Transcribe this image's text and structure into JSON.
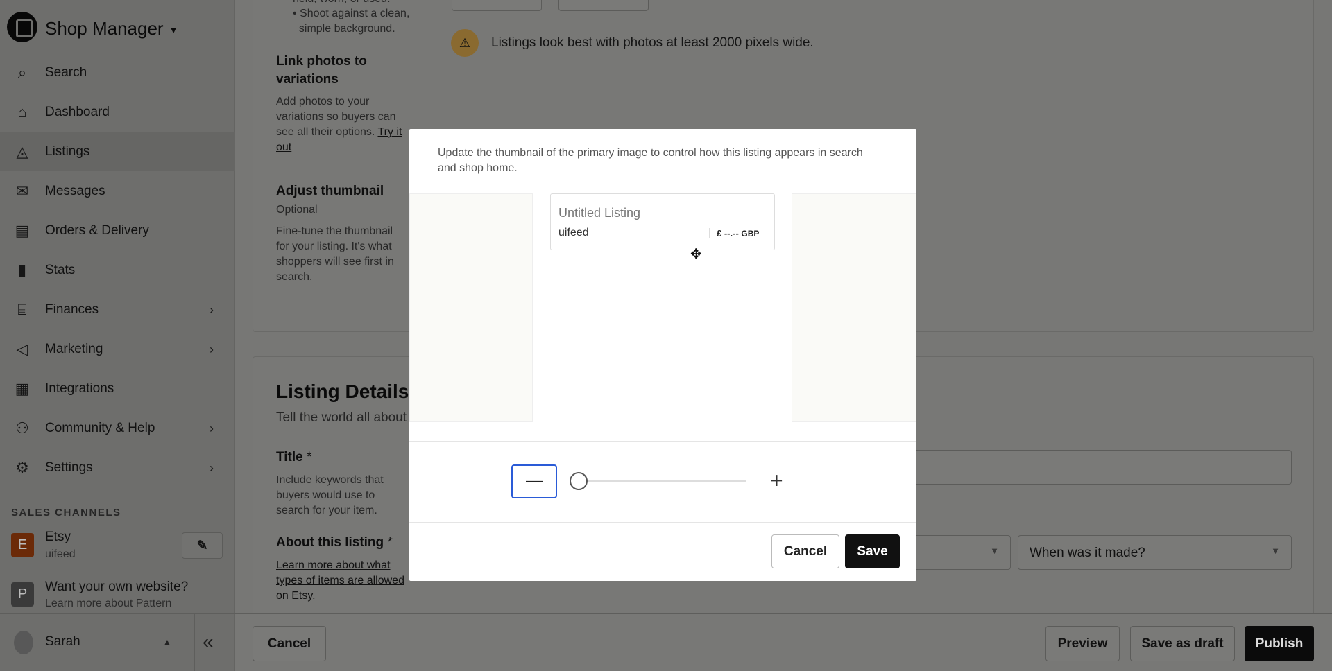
{
  "sidebar": {
    "brand": "Shop Manager",
    "items": [
      {
        "label": "Search",
        "icon": "search-icon",
        "glyph": "⌕"
      },
      {
        "label": "Dashboard",
        "icon": "home-icon",
        "glyph": "⌂"
      },
      {
        "label": "Listings",
        "icon": "shapes-icon",
        "glyph": "◬"
      },
      {
        "label": "Messages",
        "icon": "envelope-icon",
        "glyph": "✉"
      },
      {
        "label": "Orders & Delivery",
        "icon": "clipboard-icon",
        "glyph": "▤"
      },
      {
        "label": "Stats",
        "icon": "bar-chart-icon",
        "glyph": "▮"
      },
      {
        "label": "Finances",
        "icon": "bank-icon",
        "glyph": "⌸",
        "chevron": true
      },
      {
        "label": "Marketing",
        "icon": "megaphone-icon",
        "glyph": "◁",
        "chevron": true
      },
      {
        "label": "Integrations",
        "icon": "grid-icon",
        "glyph": "▦"
      },
      {
        "label": "Community & Help",
        "icon": "people-icon",
        "glyph": "⚇",
        "chevron": true
      },
      {
        "label": "Settings",
        "icon": "gear-icon",
        "glyph": "⚙",
        "chevron": true
      }
    ],
    "active": "Listings",
    "sales_channels_label": "SALES CHANNELS",
    "etsy": {
      "badge": "E",
      "name": "Etsy",
      "shop": "uifeed",
      "color": "#d5500f"
    },
    "pattern": {
      "badge": "P",
      "title": "Want your own website?",
      "subtitle": "Learn more about Pattern"
    },
    "user": "Sarah"
  },
  "photos": {
    "bullet_partial": "held, worn, or used.",
    "bullet": [
      "Shoot against a clean,",
      "simple background."
    ],
    "link_heading": "Link photos to variations",
    "link_desc": "Add photos to your variations so buyers can see all their options.",
    "link_cta": "Try it out",
    "adjust_heading": "Adjust thumbnail",
    "adjust_optional": "Optional",
    "adjust_desc": "Fine-tune the thumbnail for your listing. It's what shoppers will see first in search.",
    "warning": "Listings look best with photos at least 2000 pixels wide.",
    "warning_color": "#e8a93c"
  },
  "details": {
    "heading": "Listing Details",
    "subtitle": "Tell the world all about",
    "title_label": "Title",
    "required": "*",
    "title_desc": "Include keywords that buyers would use to search for your item.",
    "about_label": "About this listing",
    "about_link": "Learn more about what types of items are allowed on Etsy.",
    "when_made": "When was it made?"
  },
  "footer": {
    "cancel": "Cancel",
    "preview": "Preview",
    "save_draft": "Save as draft",
    "publish": "Publish"
  },
  "modal": {
    "description": "Update the thumbnail of the primary image to control how this listing appears in search and shop home.",
    "preview_title": "Untitled Listing",
    "preview_shop": "uifeed",
    "preview_price": "£ --.--",
    "preview_currency": "GBP",
    "zoom_level": 0,
    "cancel": "Cancel",
    "save": "Save",
    "accent": "#2a5bd7"
  }
}
